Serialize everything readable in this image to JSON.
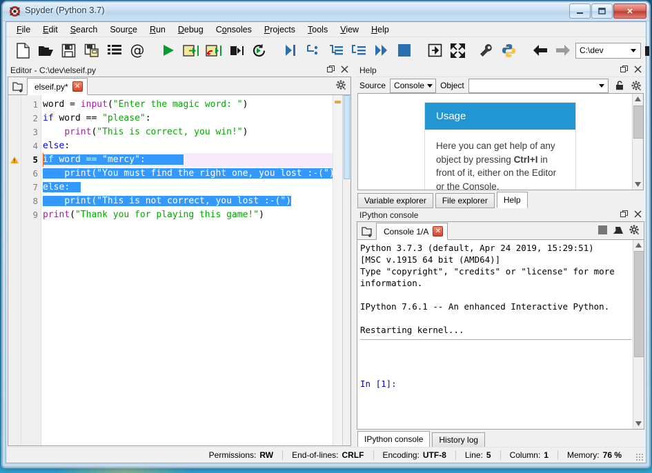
{
  "window": {
    "title": "Spyder (Python 3.7)",
    "icon": "spyder-logo-icon",
    "minimize": "–",
    "maximize": "❐",
    "close": "✕"
  },
  "menubar": {
    "items": [
      {
        "label": "File",
        "mnemonic": "F"
      },
      {
        "label": "Edit",
        "mnemonic": "E"
      },
      {
        "label": "Search",
        "mnemonic": "S"
      },
      {
        "label": "Source",
        "mnemonic": "c"
      },
      {
        "label": "Run",
        "mnemonic": "R"
      },
      {
        "label": "Debug",
        "mnemonic": "D"
      },
      {
        "label": "Consoles",
        "mnemonic": "o"
      },
      {
        "label": "Projects",
        "mnemonic": "P"
      },
      {
        "label": "Tools",
        "mnemonic": "T"
      },
      {
        "label": "View",
        "mnemonic": "V"
      },
      {
        "label": "Help",
        "mnemonic": "H"
      }
    ]
  },
  "toolbar": {
    "icons": [
      "new-file-icon",
      "open-file-icon",
      "save-file-icon",
      "save-all-icon",
      "file-list-icon",
      "at-sign-icon",
      "run-icon",
      "run-cell-icon",
      "run-cell-advance-icon",
      "run-selection-icon",
      "re-run-icon",
      "debug-icon",
      "debug-step-over-icon",
      "debug-step-into-icon",
      "debug-step-return-icon",
      "debug-continue-icon",
      "debug-stop-icon",
      "maximize-pane-icon",
      "fullscreen-icon",
      "preferences-icon",
      "python-path-icon",
      "back-icon",
      "forward-icon"
    ],
    "path_value": "C:\\dev",
    "browse_dir_icon": "open-folder-icon",
    "parent_dir_icon": "up-arrow-icon"
  },
  "editor": {
    "dock_title": "Editor - C:\\dev\\elseif.py",
    "undock_icon": "undock-icon",
    "close_icon": "close-icon",
    "browse_tabs_icon": "browse-tabs-icon",
    "options_icon": "gear-icon",
    "tab": {
      "label": "elseif.py*",
      "close": "✕"
    },
    "lines": [
      {
        "n": "1",
        "warn": false,
        "current": false,
        "tokens": [
          {
            "t": "word = ",
            "c": "plain"
          },
          {
            "t": "input",
            "c": "bi"
          },
          {
            "t": "(",
            "c": "plain"
          },
          {
            "t": "\"Enter the magic word: \"",
            "c": "str"
          },
          {
            "t": ")",
            "c": "plain"
          }
        ]
      },
      {
        "n": "2",
        "warn": false,
        "current": false,
        "tokens": [
          {
            "t": "if",
            "c": "kw"
          },
          {
            "t": " word == ",
            "c": "plain"
          },
          {
            "t": "\"please\"",
            "c": "str"
          },
          {
            "t": ":",
            "c": "plain"
          }
        ]
      },
      {
        "n": "3",
        "warn": false,
        "current": false,
        "tokens": [
          {
            "t": "    ",
            "c": "plain"
          },
          {
            "t": "print",
            "c": "bi"
          },
          {
            "t": "(",
            "c": "plain"
          },
          {
            "t": "\"This is correct, you win!\"",
            "c": "str"
          },
          {
            "t": ")",
            "c": "plain"
          }
        ]
      },
      {
        "n": "4",
        "warn": false,
        "current": false,
        "tokens": [
          {
            "t": "else",
            "c": "kw"
          },
          {
            "t": ":",
            "c": "plain"
          }
        ]
      },
      {
        "n": "5",
        "warn": true,
        "current": true,
        "tokens": [
          {
            "t": "if",
            "c": "kw"
          },
          {
            "t": " word == ",
            "c": "plain"
          },
          {
            "t": "\"mercy\"",
            "c": "str"
          },
          {
            "t": ":",
            "c": "plain"
          }
        ]
      },
      {
        "n": "6",
        "warn": false,
        "current": false,
        "tokens": [
          {
            "t": "    ",
            "c": "plain"
          },
          {
            "t": "print",
            "c": "bi"
          },
          {
            "t": "(",
            "c": "plain"
          },
          {
            "t": "\"You must find the right one, you lost :-(\"",
            "c": "str"
          },
          {
            "t": ")",
            "c": "plain"
          }
        ]
      },
      {
        "n": "7",
        "warn": false,
        "current": false,
        "tokens": [
          {
            "t": "else",
            "c": "kw"
          },
          {
            "t": ":",
            "c": "plain"
          }
        ]
      },
      {
        "n": "8",
        "warn": false,
        "current": false,
        "tokens": [
          {
            "t": "    ",
            "c": "plain"
          },
          {
            "t": "print",
            "c": "bi"
          },
          {
            "t": "(",
            "c": "plain"
          },
          {
            "t": "\"This is not correct, you lost :-(\"",
            "c": "str"
          },
          {
            "t": ")",
            "c": "plain"
          }
        ]
      },
      {
        "n": "9",
        "warn": false,
        "current": false,
        "tokens": [
          {
            "t": "",
            "c": "plain"
          },
          {
            "t": "print",
            "c": "bi"
          },
          {
            "t": "(",
            "c": "plain"
          },
          {
            "t": "\"Thank you for playing this game!\"",
            "c": "str"
          },
          {
            "t": ")",
            "c": "plain"
          }
        ]
      }
    ],
    "selection": {
      "from_line": 5,
      "to_line": 8
    },
    "warning_line": 5,
    "colors": {
      "keyword": "#0000ff",
      "builtin": "#a020a0",
      "string": "#00aa00",
      "selection": "#3399ff",
      "current_line": "#f7eafb",
      "warning": "#f2a922"
    }
  },
  "help": {
    "dock_title": "Help",
    "undock_icon": "undock-icon",
    "close_icon": "close-icon",
    "source_label": "Source",
    "source_value": "Console",
    "object_label": "Object",
    "object_value": "",
    "lock_icon": "lock-open-icon",
    "options_icon": "gear-icon",
    "card": {
      "heading": "Usage",
      "body_1": "Here you can get help of any object by pressing ",
      "body_bold": "Ctrl+I",
      "body_2": " in front of it, either on the Editor or the Console."
    },
    "tabs": [
      {
        "label": "Variable explorer",
        "active": false
      },
      {
        "label": "File explorer",
        "active": false
      },
      {
        "label": "Help",
        "active": true
      }
    ]
  },
  "console": {
    "dock_title": "IPython console",
    "undock_icon": "undock-icon",
    "close_icon": "close-icon",
    "browse_tabs_icon": "browse-tabs-icon",
    "tab": {
      "label": "Console 1/A",
      "close": "✕"
    },
    "tools": [
      "stop-icon",
      "clear-console-icon",
      "gear-icon"
    ],
    "output_lines": [
      {
        "text": "Python 3.7.3 (default, Apr 24 2019, 15:29:51)",
        "style": "plain"
      },
      {
        "text": "[MSC v.1915 64 bit (AMD64)]",
        "style": "plain"
      },
      {
        "text": "Type \"copyright\", \"credits\" or \"license\" for more",
        "style": "plain"
      },
      {
        "text": "information.",
        "style": "plain"
      },
      {
        "text": "",
        "style": "plain"
      },
      {
        "text": "IPython 7.6.1 -- An enhanced Interactive Python.",
        "style": "plain"
      },
      {
        "text": "",
        "style": "plain"
      },
      {
        "text": "Restarting kernel...",
        "style": "plain"
      },
      {
        "text": "__HR__",
        "style": "rule"
      },
      {
        "text": "",
        "style": "plain"
      },
      {
        "text": "",
        "style": "plain"
      },
      {
        "text": "",
        "style": "plain"
      },
      {
        "text": "In [1]:",
        "style": "prompt"
      }
    ],
    "tabs": [
      {
        "label": "IPython console",
        "active": true
      },
      {
        "label": "History log",
        "active": false
      }
    ]
  },
  "statusbar": {
    "items": [
      {
        "label": "Permissions:",
        "value": "RW"
      },
      {
        "label": "End-of-lines:",
        "value": "CRLF"
      },
      {
        "label": "Encoding:",
        "value": "UTF-8"
      },
      {
        "label": "Line:",
        "value": "5"
      },
      {
        "label": "Column:",
        "value": "1"
      },
      {
        "label": "Memory:",
        "value": "76 %"
      }
    ]
  }
}
